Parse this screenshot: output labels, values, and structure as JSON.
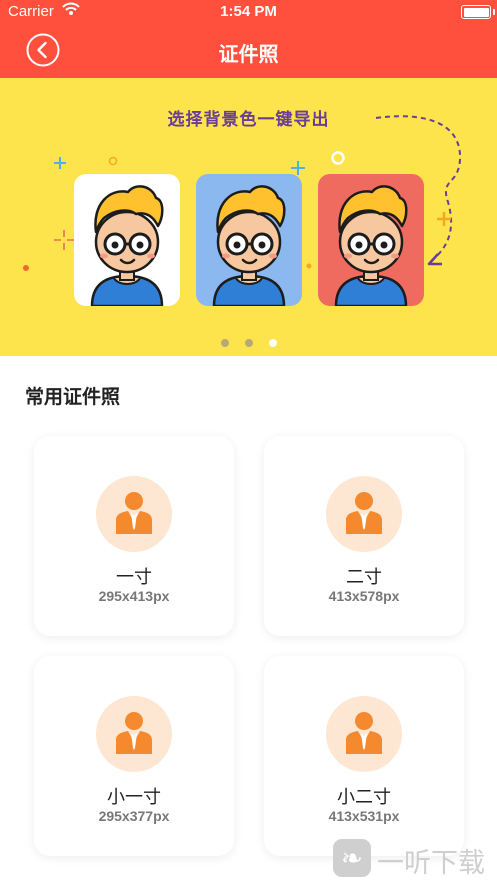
{
  "status_bar": {
    "carrier": "Carrier",
    "time": "1:54 PM"
  },
  "nav": {
    "title": "证件照",
    "back_icon": "chevron-left-circle-icon"
  },
  "banner": {
    "headline": "选择背景色一键导出",
    "card_colors": [
      "#ffffff",
      "#8ab8ef",
      "#ef6a5f"
    ],
    "page_count": 3,
    "active_page": 3
  },
  "section": {
    "title": "常用证件照"
  },
  "sizes": [
    {
      "name": "一寸",
      "dimensions": "295x413px"
    },
    {
      "name": "二寸",
      "dimensions": "413x578px"
    },
    {
      "name": "小一寸",
      "dimensions": "295x377px"
    },
    {
      "name": "小二寸",
      "dimensions": "413x531px"
    }
  ],
  "watermark": {
    "text": "一听下载"
  },
  "colors": {
    "brand_red": "#ff4f3d",
    "banner_yellow": "#fde44c",
    "avatar_orange": "#f5892e"
  }
}
